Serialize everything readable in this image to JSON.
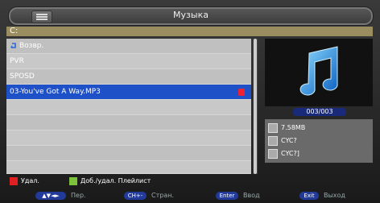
{
  "window": {
    "title": "Музыка"
  },
  "path": "C:",
  "list": [
    {
      "label": "Возвр.",
      "kind": "up"
    },
    {
      "label": "PVR",
      "kind": "folder"
    },
    {
      "label": "SPOSD",
      "kind": "folder"
    },
    {
      "label": "03-You've Got A Way.MP3",
      "kind": "file",
      "selected": true
    }
  ],
  "player": {
    "counter": "003/003",
    "info": {
      "size": "7.58MB",
      "artist": "CYC?",
      "album": "CYC?]"
    }
  },
  "keys": {
    "red": "Удал.",
    "green": "Доб./удал. Плейлист"
  },
  "nav": {
    "move_key": "▲▼◄►",
    "move_label": "Пер.",
    "page_key": "CH+-",
    "page_label": "Стран.",
    "enter_key": "Enter",
    "enter_label": "Ввод",
    "exit_key": "Exit",
    "exit_label": "Выход"
  },
  "colors": {
    "selection": "#1e50c8",
    "key_red": "#e02020",
    "key_green": "#7cc23a",
    "path_bar": "#9a8d5f"
  }
}
